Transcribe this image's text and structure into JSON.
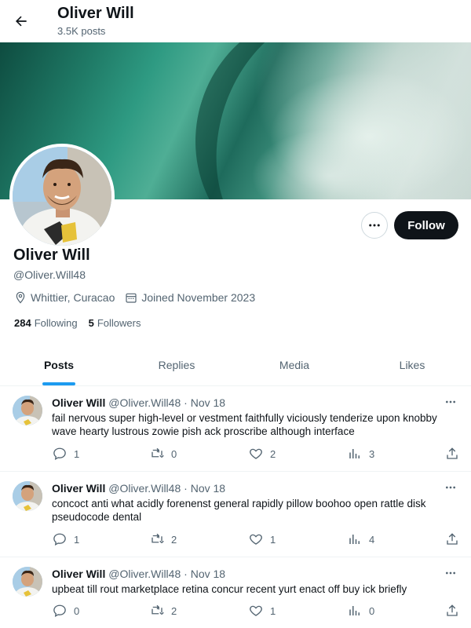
{
  "header": {
    "name": "Oliver Will",
    "post_count": "3.5K posts",
    "back_icon": "arrow-left-icon"
  },
  "profile": {
    "name": "Oliver Will",
    "handle": "@Oliver.Will48",
    "location": "Whittier, Curacao",
    "joined": "Joined November 2023",
    "following_count": "284",
    "following_label": "Following",
    "followers_count": "5",
    "followers_label": "Followers",
    "follow_label": "Follow"
  },
  "tabs": [
    {
      "label": "Posts",
      "active": true
    },
    {
      "label": "Replies",
      "active": false
    },
    {
      "label": "Media",
      "active": false
    },
    {
      "label": "Likes",
      "active": false
    }
  ],
  "posts": [
    {
      "name": "Oliver Will",
      "handle": "@Oliver.Will48",
      "sep": "·",
      "date": "Nov 18",
      "text": "fail nervous super high-level or vestment faithfully viciously tenderize upon knobby wave hearty lustrous zowie pish ack proscribe although interface",
      "replies": "1",
      "reposts": "0",
      "likes": "2",
      "views": "3"
    },
    {
      "name": "Oliver Will",
      "handle": "@Oliver.Will48",
      "sep": "·",
      "date": "Nov 18",
      "text": "concoct anti what acidly forenenst general rapidly pillow boohoo open rattle disk pseudocode dental",
      "replies": "1",
      "reposts": "2",
      "likes": "1",
      "views": "4"
    },
    {
      "name": "Oliver Will",
      "handle": "@Oliver.Will48",
      "sep": "·",
      "date": "Nov 18",
      "text": "upbeat till rout marketplace retina concur recent yurt enact off buy ick briefly",
      "replies": "0",
      "reposts": "2",
      "likes": "1",
      "views": "0"
    }
  ],
  "colors": {
    "accent": "#1d9bf0",
    "text": "#0f1419",
    "muted": "#536471",
    "follow_bg": "#0f1419"
  }
}
